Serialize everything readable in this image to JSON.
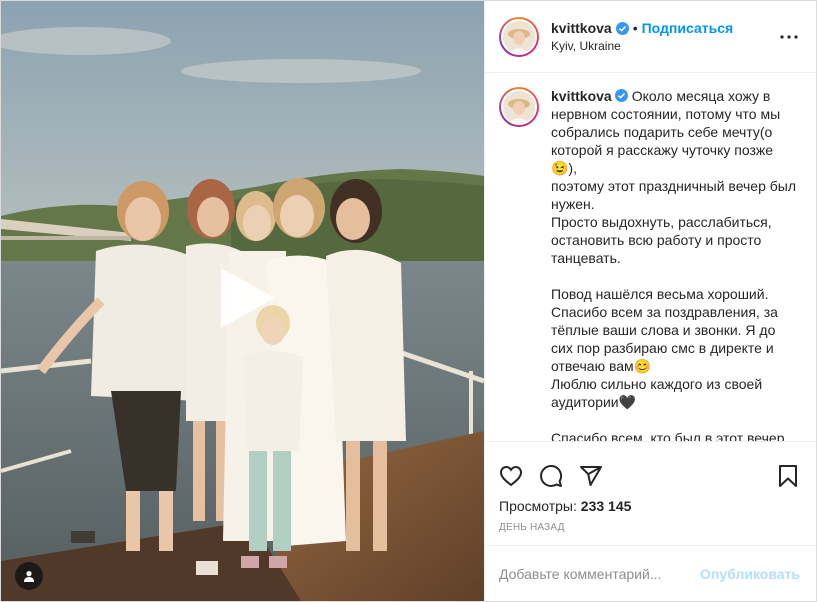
{
  "post": {
    "username": "kvittkova",
    "follow_label": "Подписаться",
    "location": "Kyiv, Ukraine",
    "caption": "Около месяца хожу в нервном состоянии, потому что мы собрались подарить себе мечту(о которой я расскажу чуточку позже 😉),\nпоэтому этот праздничный вечер был нужен.\nПросто выдохнуть, расслабиться, остановить всю работу и просто танцевать.\n\nПовод нашёлся весьма хороший.\nСпасибо всем за поздравления, за тёплые ваши слова и звонки. Я до сих пор разбираю смс в директе и отвечаю вам😊\nЛюблю сильно каждого из своей аудитории🖤\n\nСпасибо всем, кто был в этот вечер",
    "views_label": "Просмотры:",
    "views_count": "233 145",
    "timestamp": "день назад"
  },
  "comment_box": {
    "placeholder": "Добавьте комментарий...",
    "publish_label": "Опубликовать"
  },
  "icons": {
    "more": "more-options-icon",
    "like": "heart-icon",
    "comment": "comment-icon",
    "share": "share-icon",
    "save": "bookmark-icon",
    "play": "play-icon",
    "tags": "user-tag-icon",
    "verified": "verified-badge-icon"
  },
  "colors": {
    "accent": "#0095f6",
    "publish_disabled": "#b2dffc",
    "muted": "#8e8e8e"
  }
}
